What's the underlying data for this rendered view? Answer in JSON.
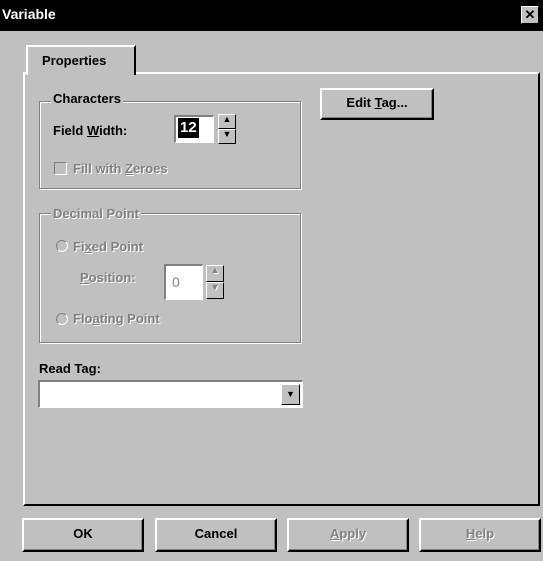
{
  "window": {
    "title": "Variable",
    "close_glyph": "✕"
  },
  "tabs": [
    {
      "label": "Properties"
    }
  ],
  "characters": {
    "group_title": "Characters",
    "field_width_label_pre": "Field ",
    "field_width_label_key": "W",
    "field_width_label_post": "idth:",
    "field_width_value": "12",
    "fill_zeroes_pre": "Fill with ",
    "fill_zeroes_key": "Z",
    "fill_zeroes_post": "eroes"
  },
  "decimal_point": {
    "group_title": "Decimal Point",
    "fixed_pre": "Fi",
    "fixed_key": "x",
    "fixed_post": "ed Point",
    "position_key": "P",
    "position_post": "osition:",
    "position_value": "0",
    "floating_pre": "Flo",
    "floating_key": "a",
    "floating_post": "ting Point"
  },
  "edit_tag": {
    "pre": "Edit ",
    "key": "T",
    "post": "ag..."
  },
  "read_tag": {
    "label_pre": "Read Ta",
    "label_key": "g",
    "label_post": ":",
    "value": ""
  },
  "buttons": {
    "ok": "OK",
    "cancel": "Cancel",
    "apply_key": "A",
    "apply_post": "pply",
    "help_key": "H",
    "help_post": "elp"
  },
  "icons": {
    "up": "▲",
    "down": "▼"
  }
}
